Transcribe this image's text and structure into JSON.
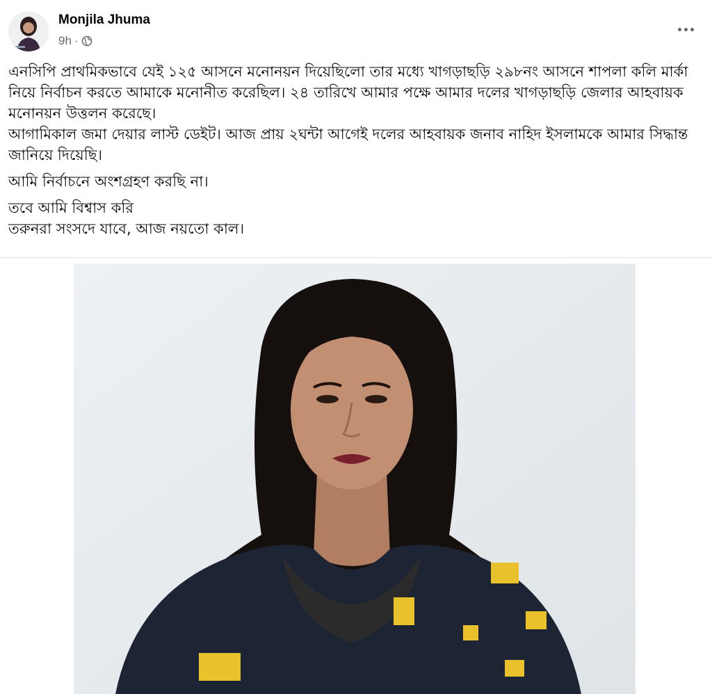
{
  "post": {
    "author": "Monjila Jhuma",
    "time": "9h",
    "separator": "·",
    "privacy_icon": "globe-icon",
    "paragraphs": [
      "এনসিপি প্রাথমিকভাবে যেই ১২৫ আসনে মনোনয়ন দিয়েছিলো তার মধ্যে খাগড়াছড়ি ২৯৮নং আসনে শাপলা কলি মার্কা নিয়ে নির্বাচন করতে আমাকে মনোনীত করেছিল।  ২৪ তারিখে আমার পক্ষে আমার দলের খাগড়াছড়ি জেলার আহবায়ক মনোনয়ন উত্তলন করেছে।\nআগামিকাল জমা দেয়ার লাস্ট ডেইট। আজ প্রায় ২ঘন্টা আগেই দলের আহবায়ক জনাব নাহিদ ইসলামকে আমার সিদ্ধান্ত জানিয়ে দিয়েছি।",
      "আমি নির্বাচনে অংশগ্রহণ করছি না।",
      "তবে আমি বিশ্বাস করি\nতরুনরা সংসদে যাবে, আজ নয়তো কাল।"
    ]
  },
  "colors": {
    "text": "#050505",
    "secondary_text": "#65676b",
    "divider": "#dddfe2",
    "photo_background": "#e6eaed"
  }
}
